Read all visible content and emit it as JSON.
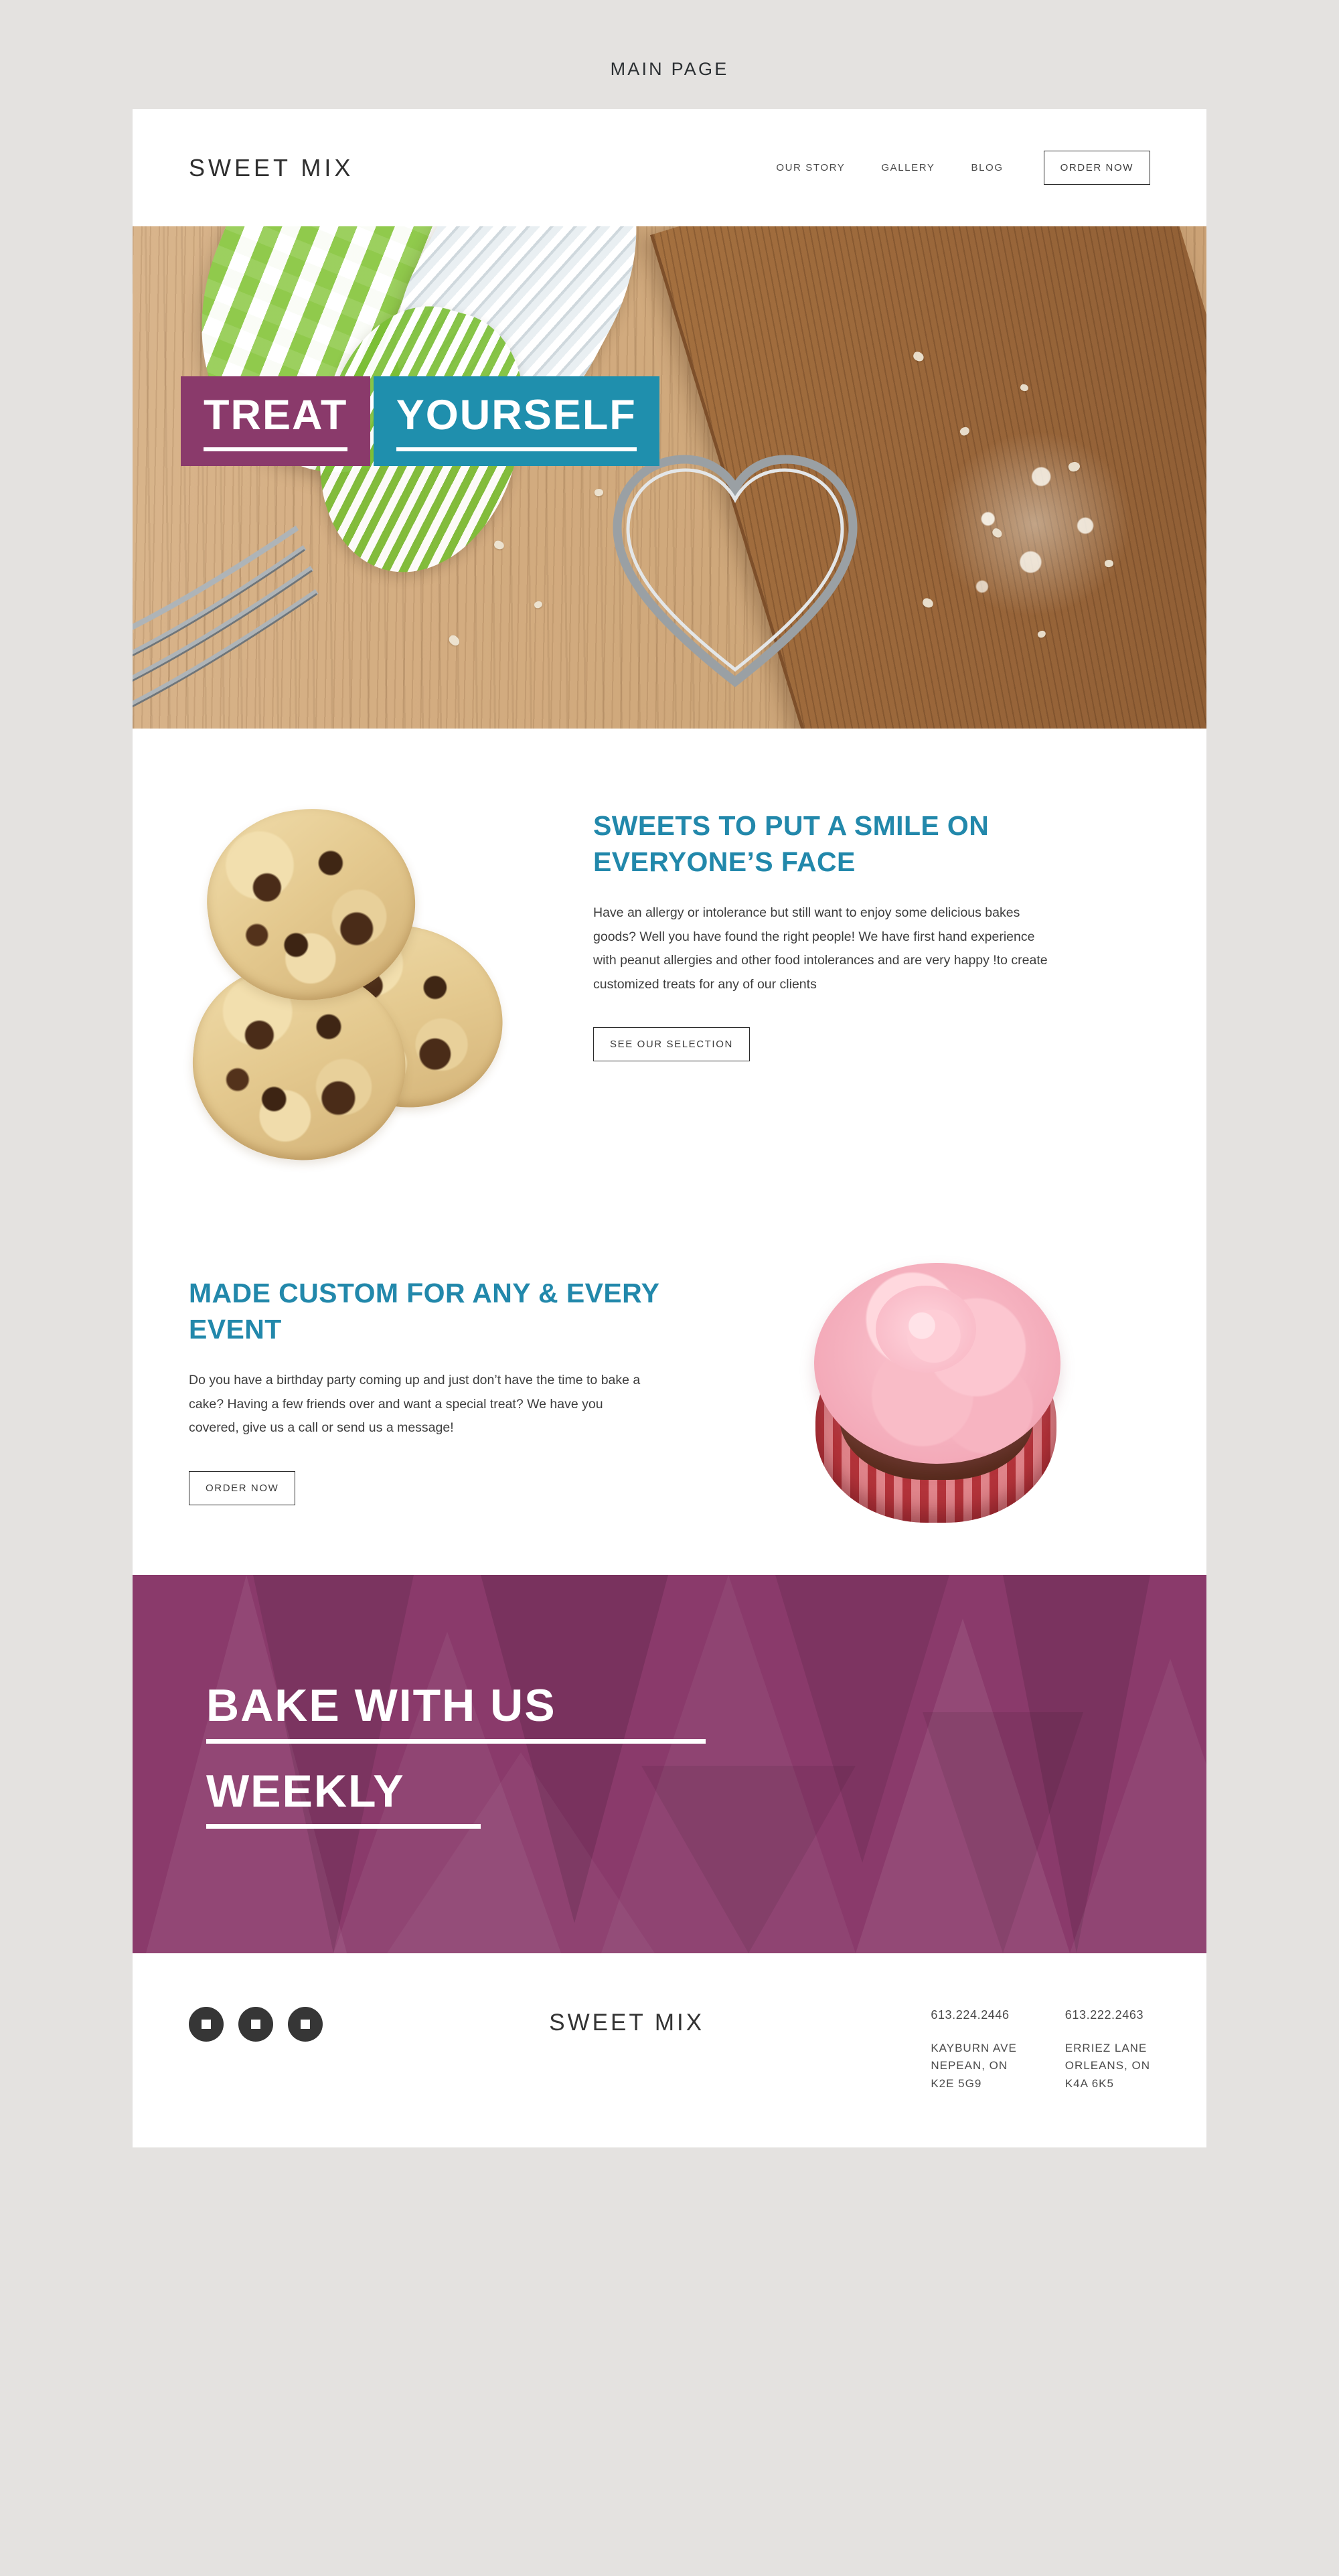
{
  "page_label": "MAIN PAGE",
  "header": {
    "brand": "SWEET MIX",
    "nav": [
      {
        "label": "OUR STORY"
      },
      {
        "label": "GALLERY"
      },
      {
        "label": "BLOG"
      }
    ],
    "cta_label": "ORDER NOW"
  },
  "hero": {
    "line1": "TREAT",
    "line2": "YOURSELF",
    "color_line1_bg": "#8a3a6b",
    "color_line2_bg": "#1f8fad"
  },
  "features": [
    {
      "title": "SWEETS TO PUT A SMILE ON EVERYONE’S FACE",
      "text": "Have an allergy or intolerance but still want to enjoy some delicious bakes goods? Well you have found the right people! We have first hand experience with peanut allergies and other food intolerances and are very happy !to create customized treats for any of our clients",
      "button": "SEE OUR SELECTION",
      "image_alt": "chocolate-chip-cookies"
    },
    {
      "title": "MADE CUSTOM FOR ANY & EVERY EVENT",
      "text": "Do you have a birthday party coming up and just don’t have the time to bake a cake? Having a few friends over and want a special treat? We have you covered, give us a call or send us a message!",
      "button": "ORDER NOW",
      "image_alt": "pink-frosted-cupcake"
    }
  ],
  "cta_banner": {
    "line1": "BAKE WITH US",
    "line2": "WEEKLY",
    "bg_color": "#8a3a6b"
  },
  "footer": {
    "brand": "SWEET MIX",
    "socials": [
      {
        "name": "social-icon-1"
      },
      {
        "name": "social-icon-2"
      },
      {
        "name": "social-icon-3"
      }
    ],
    "contacts": [
      {
        "phone": "613.224.2446",
        "address": "KAYBURN AVE\nNEPEAN, ON\nK2E 5G9"
      },
      {
        "phone": "613.222.2463",
        "address": "ERRIEZ LANE\nORLEANS, ON\nK4A 6K5"
      }
    ]
  },
  "accent_colors": {
    "teal": "#2288ab",
    "purple": "#8a3a6b",
    "page_bg": "#e4e2e0"
  }
}
